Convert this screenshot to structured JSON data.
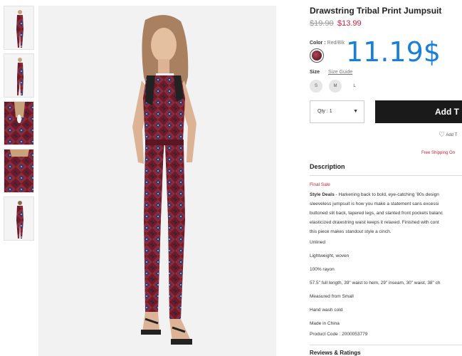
{
  "product": {
    "title": "Drawstring Tribal Print Jumpsuit",
    "price_original": "$19.90",
    "price_sale": "$13.99",
    "overlay_price": "11.19$"
  },
  "options": {
    "color_label": "Color :",
    "color_value": "Red/Blk",
    "size_label": "Size",
    "size_guide": "Size Guide",
    "sizes": [
      "S",
      "M",
      "L"
    ],
    "qty_label": "Qty : 1",
    "add_button": "Add T",
    "wishlist": "Add T",
    "shipping": "Free Shipping On"
  },
  "description": {
    "heading": "Description",
    "final_sale": "Final Sale",
    "lead_bold": "Style Deals",
    "lines": [
      " - Harkening back to bold, eye-catching '80s design",
      "sleeveless jumpsuit is how you make a statement sans excessi",
      "buttoned slit back, tapered legs, and slanted front pockets balanc",
      "elasticized drawstring waist keeps it relaxed. Finished with cont",
      "this piece makes standout style a cinch."
    ],
    "details": [
      "Unlined",
      "Lightweight, woven",
      "100% rayon",
      "57.5\" full length, 39\" waist to hem, 29\" inseam, 30\" waist, 38\" ch",
      "Measured from Small",
      "Hand wash cold",
      "Made in China",
      "Product Code : 2000053779"
    ]
  },
  "reviews": {
    "heading": "Reviews & Ratings"
  },
  "colors": {
    "sale": "#d0233b",
    "overlay": "#1a7fd8",
    "button": "#1a1a1a",
    "print": "#6b1b2a"
  }
}
